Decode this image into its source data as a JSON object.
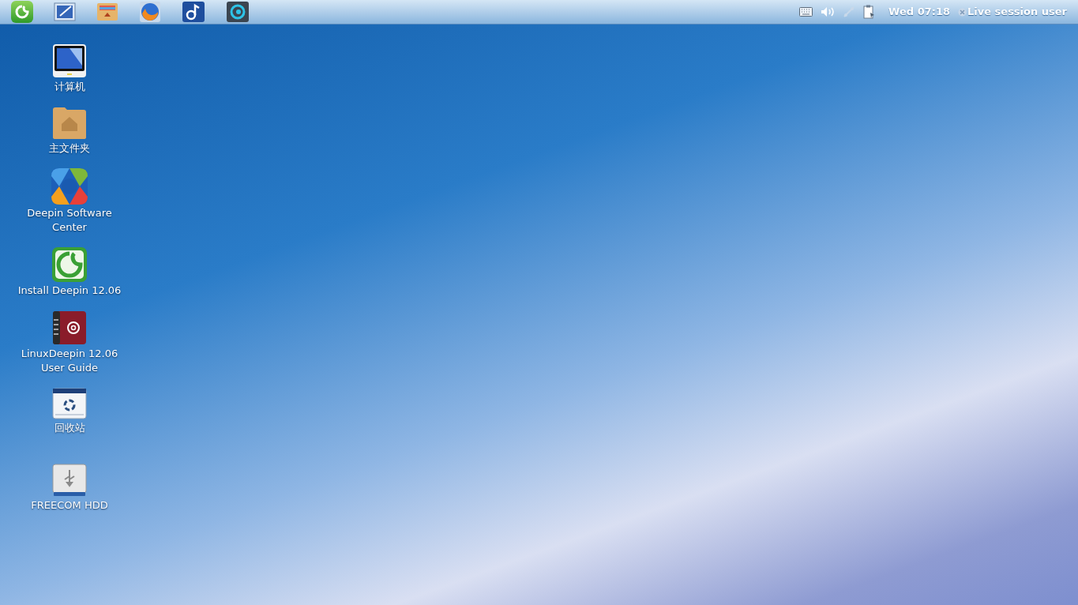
{
  "panel": {
    "clock": "Wed 07:18",
    "user": "Live session user"
  },
  "desktop_items": [
    {
      "label": "计算机",
      "kind": "computer"
    },
    {
      "label": "主文件夹",
      "kind": "home"
    },
    {
      "label": "Deepin Software Center",
      "kind": "store"
    },
    {
      "label": "Install Deepin 12.06",
      "kind": "installer"
    },
    {
      "label": "LinuxDeepin 12.06 User Guide",
      "kind": "guide"
    },
    {
      "label": "回收站",
      "kind": "trash"
    },
    {
      "label": "FREECOM HDD",
      "kind": "drive"
    }
  ]
}
